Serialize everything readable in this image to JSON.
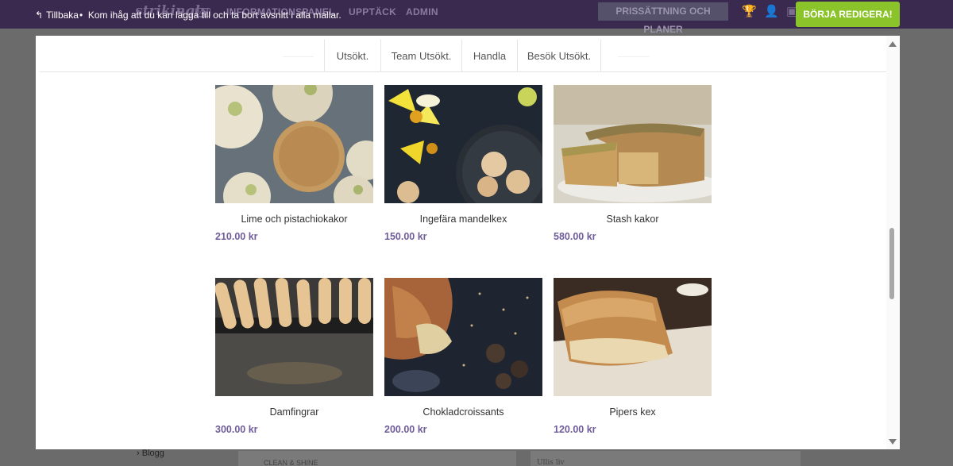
{
  "topbar": {
    "back_label": "Tillbaka",
    "separator": "•",
    "tip": "Kom ihåg att du kan lägga till och ta bort avsnitt i alla mallar.",
    "logo": "strikingly",
    "logo_badge": "VIP",
    "nav": [
      "INFORMATIONSPANEL",
      "UPPTÄCK",
      "ADMIN"
    ],
    "pricing_label": "PRISSÄTTNING OCH PLANER",
    "start_label": "BÖRJA REDIGERA!",
    "accent_color": "#8bc42a",
    "bar_color": "#3b2a4f"
  },
  "tabs": [
    "Utsökt.",
    "Team Utsökt.",
    "Handla",
    "Besök Utsökt."
  ],
  "products": [
    {
      "name": "Lime och pistachiokakor",
      "price": "210.00 kr"
    },
    {
      "name": "Ingefära mandelkex",
      "price": "150.00 kr"
    },
    {
      "name": "Stash kakor",
      "price": "580.00 kr"
    },
    {
      "name": "Damfingrar",
      "price": "300.00 kr"
    },
    {
      "name": "Chokladcroissants",
      "price": "200.00 kr"
    },
    {
      "name": "Pipers kex",
      "price": "120.00 kr"
    }
  ],
  "price_color": "#6e5d99",
  "background_page": {
    "bottom_left": "Blogg",
    "bottom_card": "CLEAN & SHINE",
    "bottom_right": "Ullis liv"
  }
}
